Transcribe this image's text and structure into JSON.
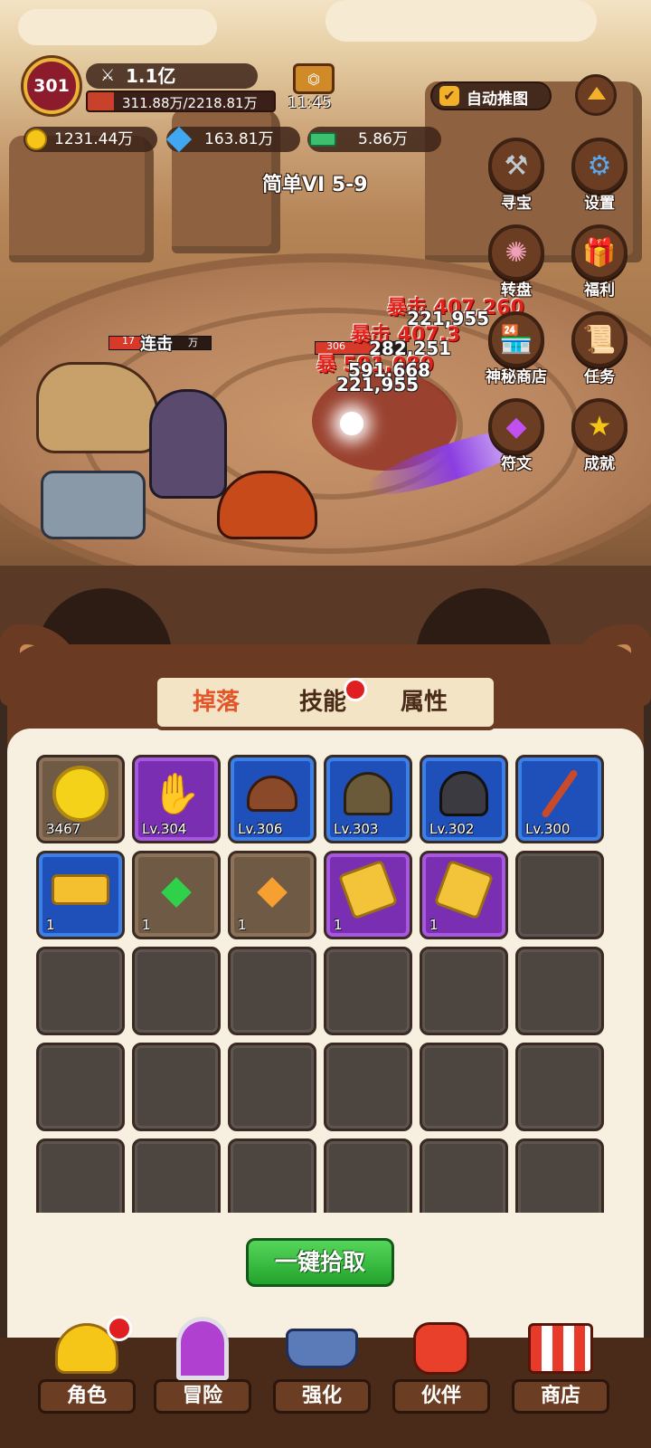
{
  "hud": {
    "level": "301",
    "power": "1.1亿",
    "hp": "311.88万/2218.81万",
    "timer": "11:45",
    "auto_push_label": "自动推图",
    "stage": "简单VI 5-9"
  },
  "currencies": [
    {
      "icon": "gold-coin-icon",
      "value": "1231.44万"
    },
    {
      "icon": "blue-diamond-icon",
      "value": "163.81万"
    },
    {
      "icon": "cash-icon",
      "value": "5.86万"
    }
  ],
  "side_menu": [
    {
      "label": "寻宝",
      "icon": "hammer-icon"
    },
    {
      "label": "设置",
      "icon": "gear-icon"
    },
    {
      "label": "转盘",
      "icon": "wheel-icon"
    },
    {
      "label": "福利",
      "icon": "gift-icon"
    },
    {
      "label": "神秘商店",
      "icon": "shop-icon"
    },
    {
      "label": "任务",
      "icon": "scroll-icon"
    },
    {
      "label": "符文",
      "icon": "gem-icon"
    },
    {
      "label": "成就",
      "icon": "star-icon"
    }
  ],
  "battle": {
    "combo_text": "连击",
    "ally_hp_left": "17",
    "ally_hp_right": "万",
    "enemy_hp": "306",
    "damage_numbers": [
      "221,955",
      "282,251",
      "591,668",
      "221,955"
    ],
    "crit_numbers": [
      "暴击",
      "407,3"
    ],
    "crit_words": [
      "暴击 407,260",
      "暴击 407,3",
      "暴 591,080"
    ]
  },
  "tabs": [
    {
      "label": "掉落",
      "active": true
    },
    {
      "label": "技能",
      "active": false,
      "badge": true
    },
    {
      "label": "属性",
      "active": false
    }
  ],
  "inventory": [
    {
      "rarity": "brown",
      "icon": "gold-coin-icon",
      "caption": "3467"
    },
    {
      "rarity": "purple",
      "icon": "gauntlet-icon",
      "caption": "Lv.304"
    },
    {
      "rarity": "blue",
      "icon": "shoulder-armor-icon",
      "caption": "Lv.306"
    },
    {
      "rarity": "blue",
      "icon": "helmet-icon",
      "caption": "Lv.303"
    },
    {
      "rarity": "blue",
      "icon": "dark-helmet-icon",
      "caption": "Lv.302"
    },
    {
      "rarity": "blue",
      "icon": "sword-icon",
      "caption": "Lv.300"
    },
    {
      "rarity": "blue",
      "icon": "paw-ticket-icon",
      "caption": "1"
    },
    {
      "rarity": "brown",
      "icon": "green-gem-icon",
      "caption": "1"
    },
    {
      "rarity": "brown",
      "icon": "orange-gem-icon",
      "caption": "1"
    },
    {
      "rarity": "purple",
      "icon": "puzzle-piece-icon",
      "caption": "1"
    },
    {
      "rarity": "purple",
      "icon": "puzzle-piece-icon",
      "caption": "1"
    }
  ],
  "pickup_button": "一键拾取",
  "bottom_nav": [
    {
      "label": "角色",
      "icon": "coin-stack-icon",
      "badge": true
    },
    {
      "label": "冒险",
      "icon": "portal-icon",
      "badge": false
    },
    {
      "label": "强化",
      "icon": "anvil-icon",
      "badge": false
    },
    {
      "label": "伙伴",
      "icon": "partner-icon",
      "badge": false
    },
    {
      "label": "商店",
      "icon": "market-stall-icon",
      "badge": false
    }
  ],
  "colors": {
    "active_tab": "#e2562a",
    "crit_red": "#e2231a",
    "purple_rarity": "#7a2fb2",
    "blue_rarity": "#1f4fb8",
    "pickup_green": "#23a32c"
  }
}
